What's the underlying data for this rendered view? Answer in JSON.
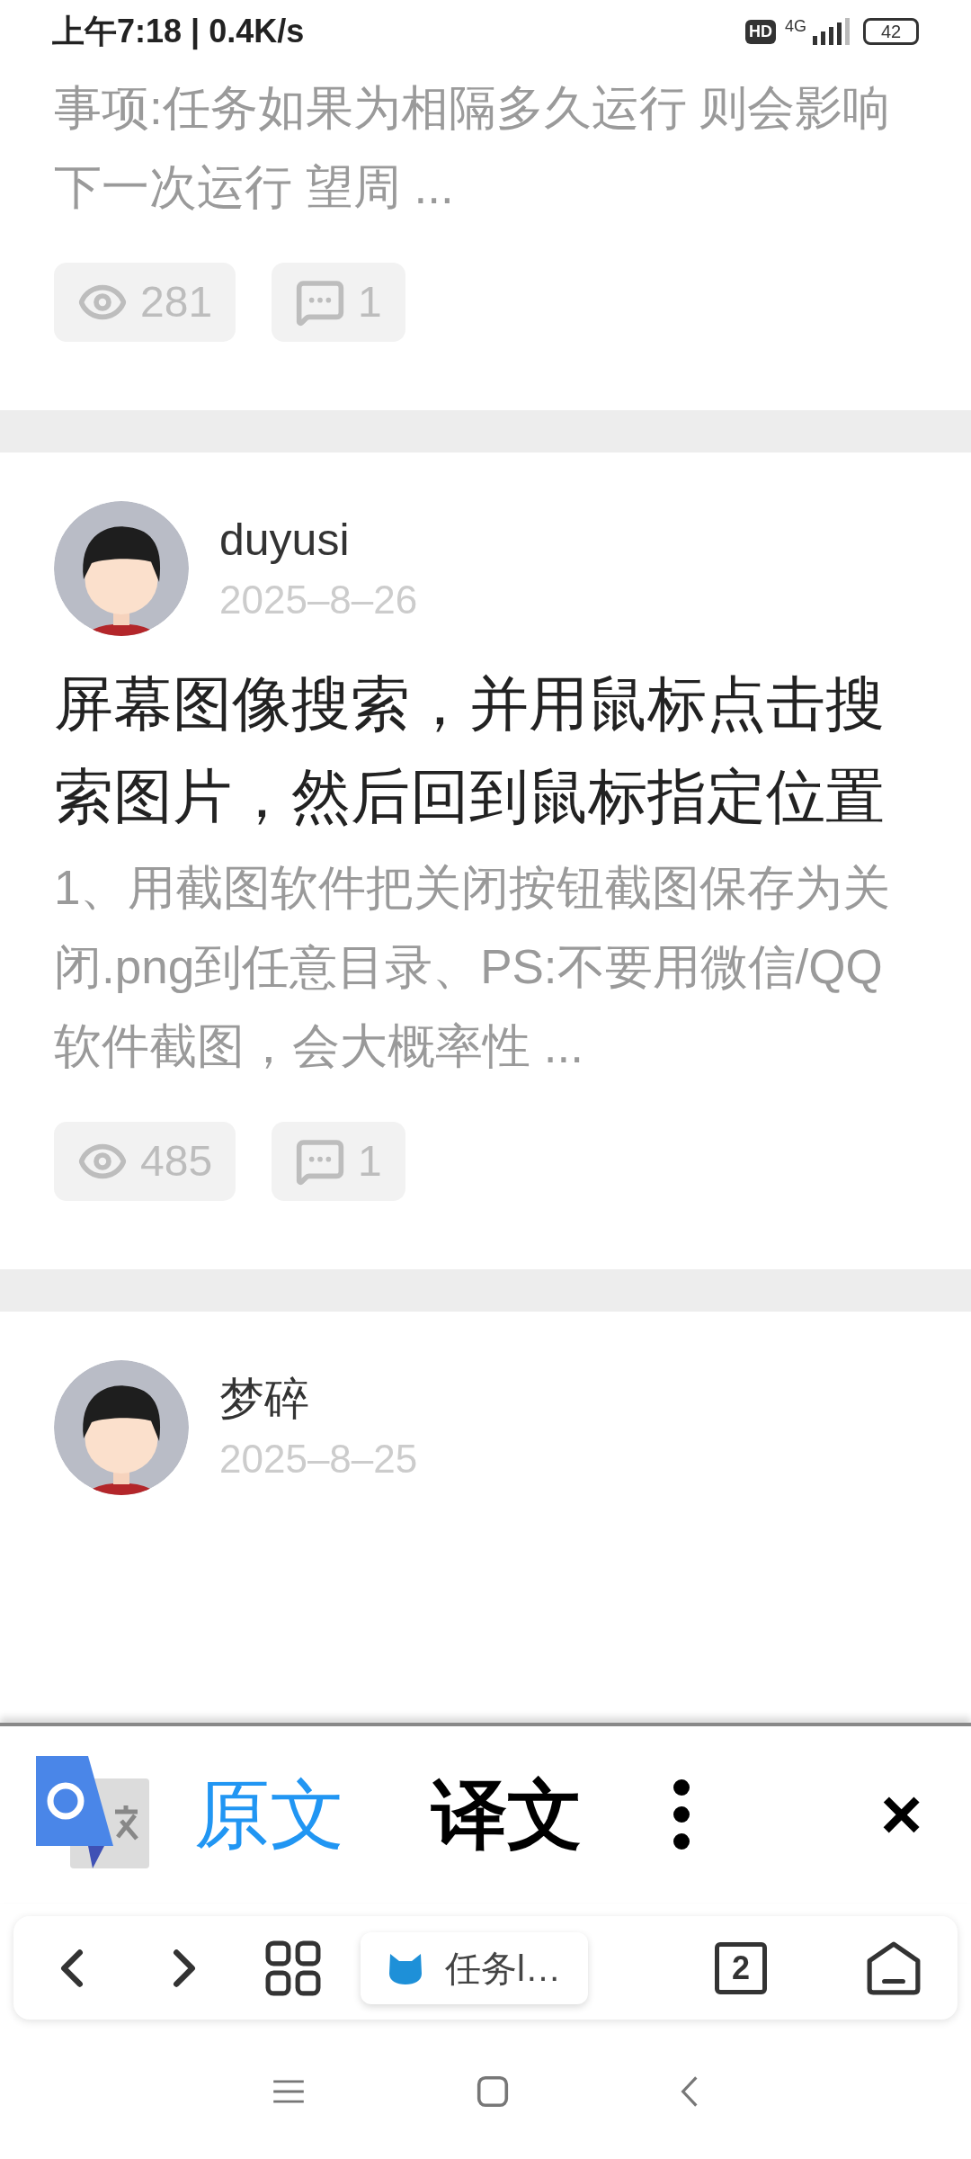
{
  "status_bar": {
    "time": "上午7:18 | 0.4K/s",
    "hd": "HD",
    "network": "4G",
    "battery": "42"
  },
  "posts": [
    {
      "excerpt": "事项:任务如果为相隔多久运行 则会影响下一次运行 望周 ...",
      "views": "281",
      "comments": "1"
    },
    {
      "author": "duyusi",
      "date": "2025–8–26",
      "title": "屏幕图像搜索，并用鼠标点击搜索图片，然后回到鼠标指定位置",
      "excerpt": "1、用截图软件把关闭按钮截图保存为关闭.png到任意目录、PS:不要用微信/QQ软件截图，会大概率性 ...",
      "views": "485",
      "comments": "1"
    },
    {
      "author": "梦碎",
      "date": "2025–8–25"
    }
  ],
  "translate_bar": {
    "tabs": [
      {
        "label": "原文",
        "selected": true
      },
      {
        "label": "译文",
        "selected": false
      }
    ],
    "close": "×"
  },
  "browser_toolbar": {
    "tab_title": "任务l…",
    "tab_count": "2"
  }
}
